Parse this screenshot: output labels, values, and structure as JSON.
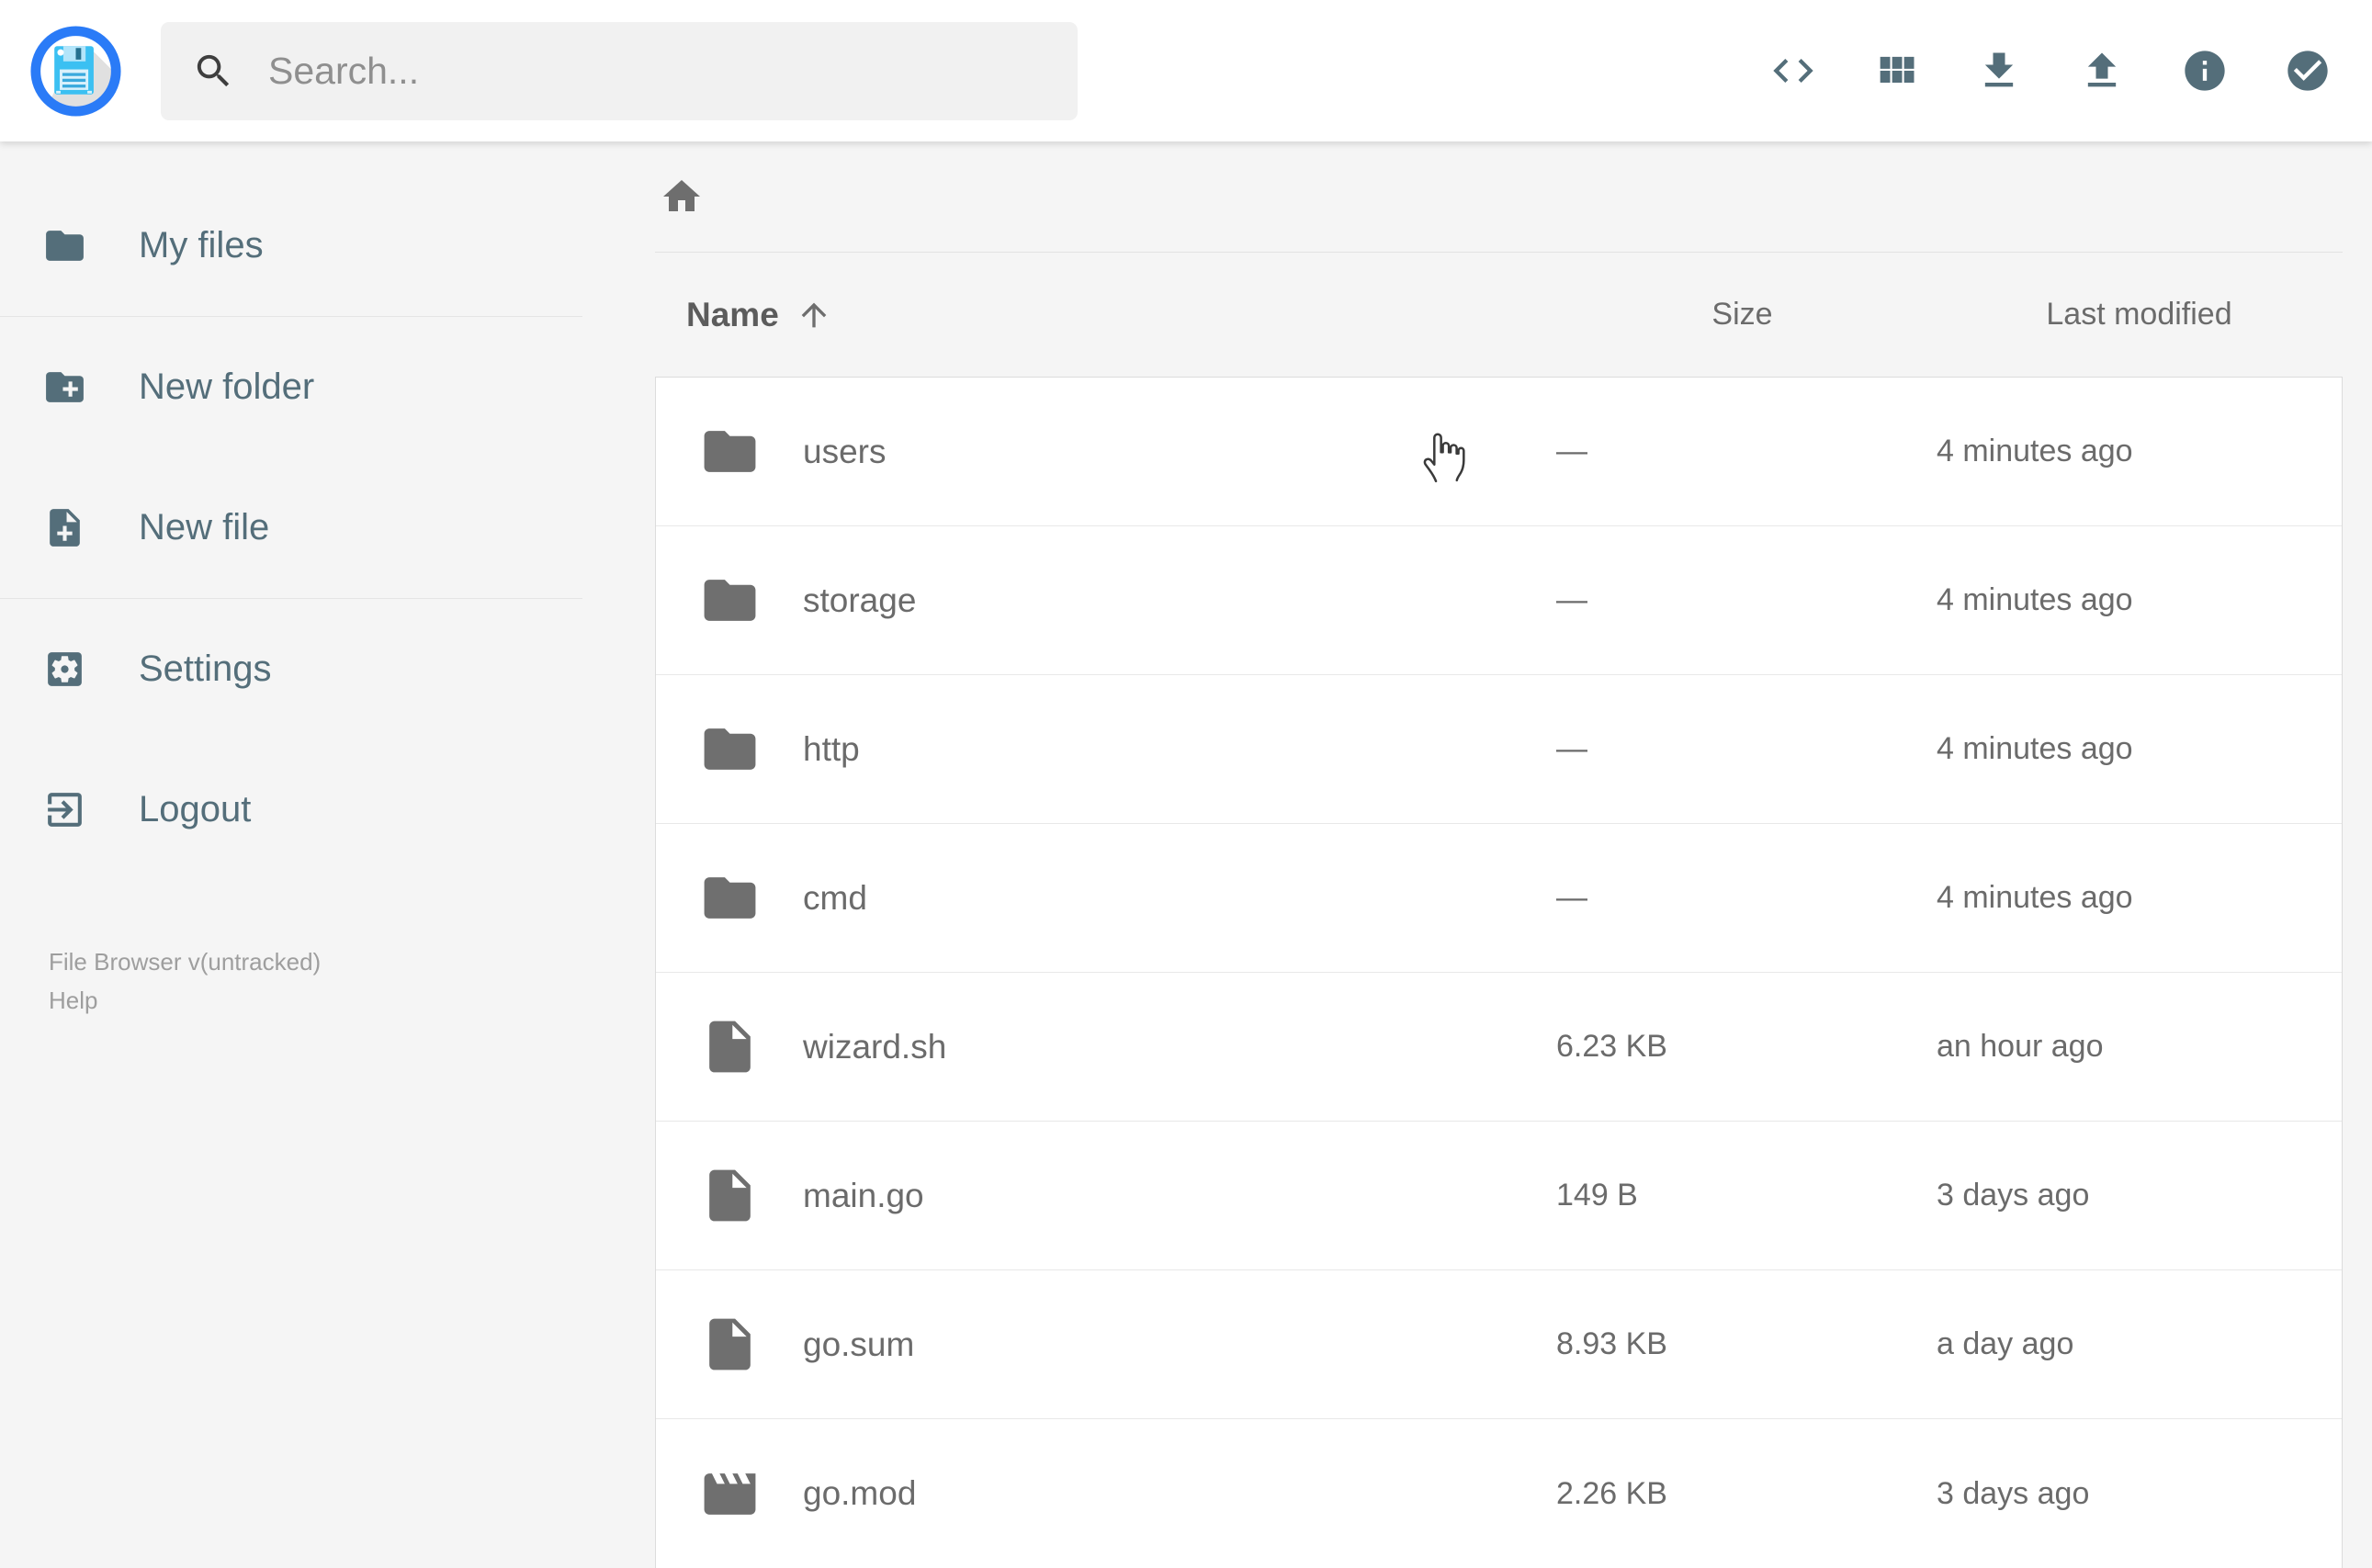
{
  "app": {
    "name": "File Browser"
  },
  "colors": {
    "accent_blue": "#2a7bf7",
    "floppy_blue": "#3bc0f2",
    "sidebar_slate": "#546e7a",
    "text_gray": "#6b6b6b",
    "background": "#f5f5f5",
    "surface": "#ffffff",
    "border": "#dcdcdc",
    "placeholder_gray": "#8f8f8f"
  },
  "header": {
    "logo_icon": "floppy-disk-logo",
    "search": {
      "placeholder": "Search...",
      "icon": "search-icon",
      "value": ""
    },
    "toolbar": [
      {
        "name": "shell",
        "icon": "code-icon"
      },
      {
        "name": "switch-view",
        "icon": "grid-view-icon"
      },
      {
        "name": "download",
        "icon": "download-icon"
      },
      {
        "name": "upload",
        "icon": "upload-icon"
      },
      {
        "name": "info",
        "icon": "info-icon"
      },
      {
        "name": "select-multiple",
        "icon": "check-circle-icon"
      }
    ]
  },
  "sidebar": {
    "items": [
      {
        "label": "My files",
        "icon": "folder-icon"
      },
      {
        "label": "New folder",
        "icon": "new-folder-icon"
      },
      {
        "label": "New file",
        "icon": "new-file-icon"
      },
      {
        "label": "Settings",
        "icon": "settings-icon"
      },
      {
        "label": "Logout",
        "icon": "logout-icon"
      }
    ],
    "footer": {
      "version": "File Browser v(untracked)",
      "help": "Help"
    }
  },
  "main": {
    "breadcrumb": {
      "home_icon": "home-icon"
    },
    "listing": {
      "columns": {
        "name": "Name",
        "size": "Size",
        "modified": "Last modified"
      },
      "sort": {
        "column": "name",
        "direction": "asc",
        "icon": "arrow-upward-icon"
      },
      "rows": [
        {
          "name": "users",
          "type": "folder",
          "size": "—",
          "modified": "4 minutes ago"
        },
        {
          "name": "storage",
          "type": "folder",
          "size": "—",
          "modified": "4 minutes ago"
        },
        {
          "name": "http",
          "type": "folder",
          "size": "—",
          "modified": "4 minutes ago"
        },
        {
          "name": "cmd",
          "type": "folder",
          "size": "—",
          "modified": "4 minutes ago"
        },
        {
          "name": "wizard.sh",
          "type": "file",
          "size": "6.23 KB",
          "modified": "an hour ago"
        },
        {
          "name": "main.go",
          "type": "file",
          "size": "149 B",
          "modified": "3 days ago"
        },
        {
          "name": "go.sum",
          "type": "file",
          "size": "8.93 KB",
          "modified": "a day ago"
        },
        {
          "name": "go.mod",
          "type": "movie",
          "size": "2.26 KB",
          "modified": "3 days ago"
        }
      ]
    }
  },
  "cursor": {
    "visible": true,
    "kind": "hand-pointer"
  }
}
